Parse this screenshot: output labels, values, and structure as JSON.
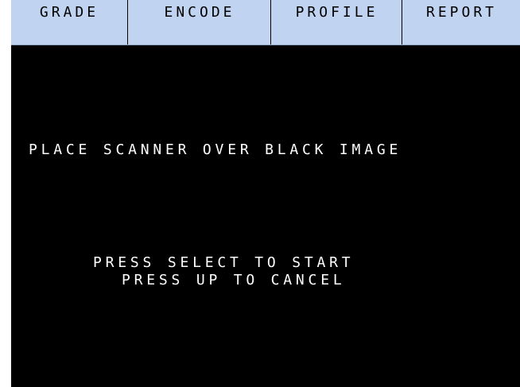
{
  "tabs": [
    {
      "label": "GRADE"
    },
    {
      "label": "ENCODE"
    },
    {
      "label": "PROFILE"
    },
    {
      "label": "REPORT"
    }
  ],
  "screen": {
    "instruction": "PLACE SCANNER OVER BLACK IMAGE",
    "prompt_start": "PRESS SELECT TO START",
    "prompt_cancel": "PRESS UP TO CANCEL"
  },
  "colors": {
    "tab_background": "#c0d4f2",
    "screen_background": "#000000",
    "text": "#ffffff"
  }
}
